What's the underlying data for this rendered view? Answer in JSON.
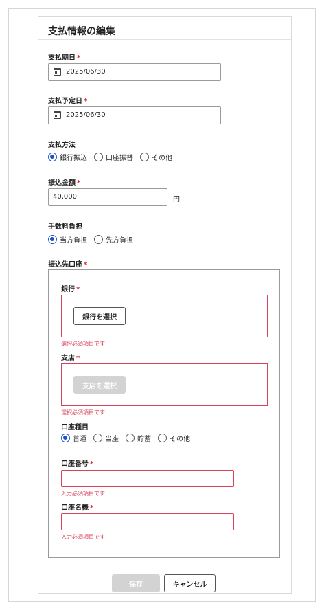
{
  "dialog": {
    "title": "支払情報の編集",
    "required_mark": "*"
  },
  "payment_date": {
    "label": "支払期日",
    "value": "2025/06/30"
  },
  "scheduled_date": {
    "label": "支払予定日",
    "value": "2025/06/30"
  },
  "payment_method": {
    "label": "支払方法",
    "options": [
      "銀行振込",
      "口座振替",
      "その他"
    ],
    "selected": "銀行振込"
  },
  "transfer_amount": {
    "label": "振込金額",
    "value": "40,000",
    "unit": "円"
  },
  "fee_bearer": {
    "label": "手数料負担",
    "options": [
      "当方負担",
      "先方負担"
    ],
    "selected": "当方負担"
  },
  "account": {
    "label": "振込先口座",
    "bank": {
      "label": "銀行",
      "button": "銀行を選択",
      "error": "選択必須項目です"
    },
    "branch": {
      "label": "支店",
      "button": "支店を選択",
      "error": "選択必須項目です"
    },
    "account_type": {
      "label": "口座種目",
      "options": [
        "普通",
        "当座",
        "貯蓄",
        "その他"
      ],
      "selected": "普通"
    },
    "account_number": {
      "label": "口座番号",
      "value": "",
      "error": "入力必須項目です"
    },
    "account_name": {
      "label": "口座名義",
      "value": "",
      "error": "入力必須項目です"
    }
  },
  "footer": {
    "save": "保存",
    "cancel": "キャンセル"
  },
  "colors": {
    "accent": "#1e53c8",
    "error": "#d9415a",
    "required": "#d32f2f",
    "disabled": "#d3d3d3"
  }
}
